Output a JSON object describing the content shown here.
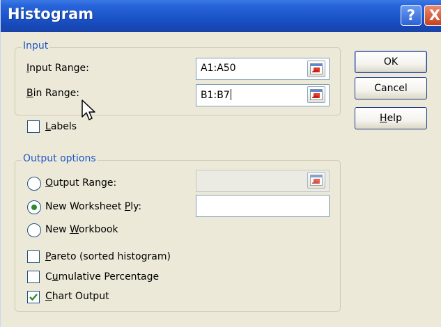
{
  "window": {
    "title": "Histogram",
    "help_glyph": "?",
    "close_glyph": "X"
  },
  "input_group": {
    "title": "Input",
    "input_range": {
      "label_u": "I",
      "label_rest": "nput Range:",
      "value": "A1:A50"
    },
    "bin_range": {
      "label_u": "B",
      "label_rest": "in Range:",
      "value": "B1:B7"
    },
    "labels": {
      "label_u": "L",
      "label_rest": "abels",
      "checked": false
    }
  },
  "buttons": {
    "ok": "OK",
    "cancel": "Cancel",
    "help_u": "H",
    "help_rest": "elp"
  },
  "output_group": {
    "title": "Output options",
    "output_range": {
      "label_u": "O",
      "label_rest": "utput Range:",
      "value": "",
      "selected": false
    },
    "new_worksheet": {
      "label_pre": "New Worksheet ",
      "label_u": "P",
      "label_rest": "ly:",
      "value": "",
      "selected": true
    },
    "new_workbook": {
      "label_pre": "New ",
      "label_u": "W",
      "label_rest": "orkbook",
      "selected": false
    },
    "pareto": {
      "label_u": "P",
      "label_rest": "areto (sorted histogram)",
      "checked": false
    },
    "cumulative": {
      "label_pre": "C",
      "label_u": "u",
      "label_rest": "mulative Percentage",
      "checked": false
    },
    "chart_output": {
      "label_u": "C",
      "label_rest": "hart Output",
      "checked": true
    }
  },
  "icons": {
    "ref_button": "collapse-dialog-icon",
    "cursor": "mouse-pointer-icon",
    "check": "checkmark-icon"
  },
  "colors": {
    "titlebar": "#1b54c9",
    "dialog_bg": "#ece9d8",
    "group_title": "#1f57c8",
    "check_green": "#2a8b2a"
  }
}
